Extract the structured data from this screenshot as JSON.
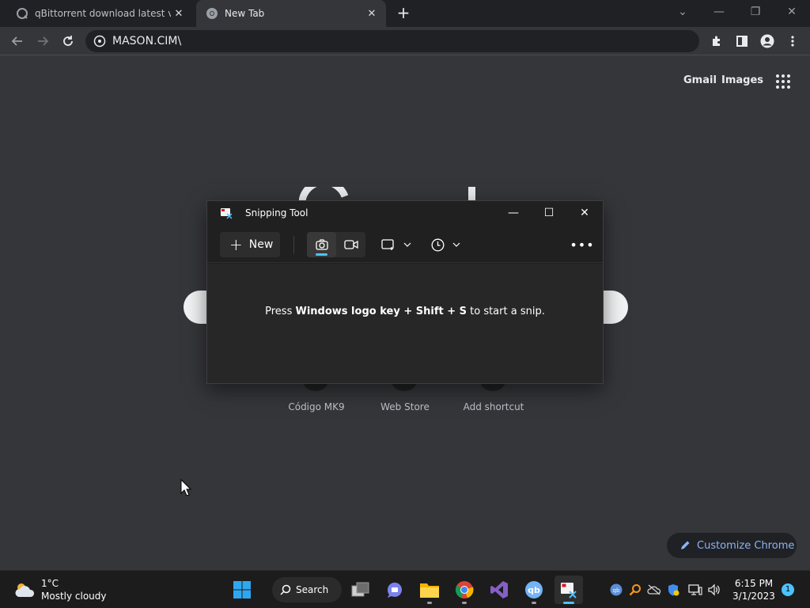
{
  "browser": {
    "tabs": [
      {
        "title": "qBittorrent download latest versi",
        "close": "✕"
      },
      {
        "title": "New Tab",
        "close": "✕"
      }
    ],
    "new_tab": "+",
    "window_controls": {
      "tab_search": "⌄",
      "minimize": "—",
      "restore": "❐",
      "close": "✕"
    },
    "address": "MASON.CIM\\",
    "colors": {
      "frame": "#202124",
      "toolbar": "#35363a",
      "link": "#8ab4f8"
    }
  },
  "ntp": {
    "gmail": "Gmail",
    "images": "Images",
    "shortcuts": [
      {
        "label": "Código MK9"
      },
      {
        "label": "Web Store"
      },
      {
        "label": "Add shortcut"
      }
    ],
    "customize": "Customize Chrome"
  },
  "snipping_tool": {
    "title": "Snipping Tool",
    "new_label": "New",
    "hint_pre": "Press ",
    "hint_keys": "Windows logo key + Shift + S",
    "hint_post": " to start a snip.",
    "more": "•••",
    "window_controls": {
      "minimize": "—",
      "maximize": "☐",
      "close": "✕"
    },
    "accent": "#4cc2ff"
  },
  "taskbar": {
    "weather_temp": "1°C",
    "weather_desc": "Mostly cloudy",
    "search_label": "Search",
    "time": "6:15 PM",
    "date": "3/1/2023",
    "notification_count": "1"
  }
}
